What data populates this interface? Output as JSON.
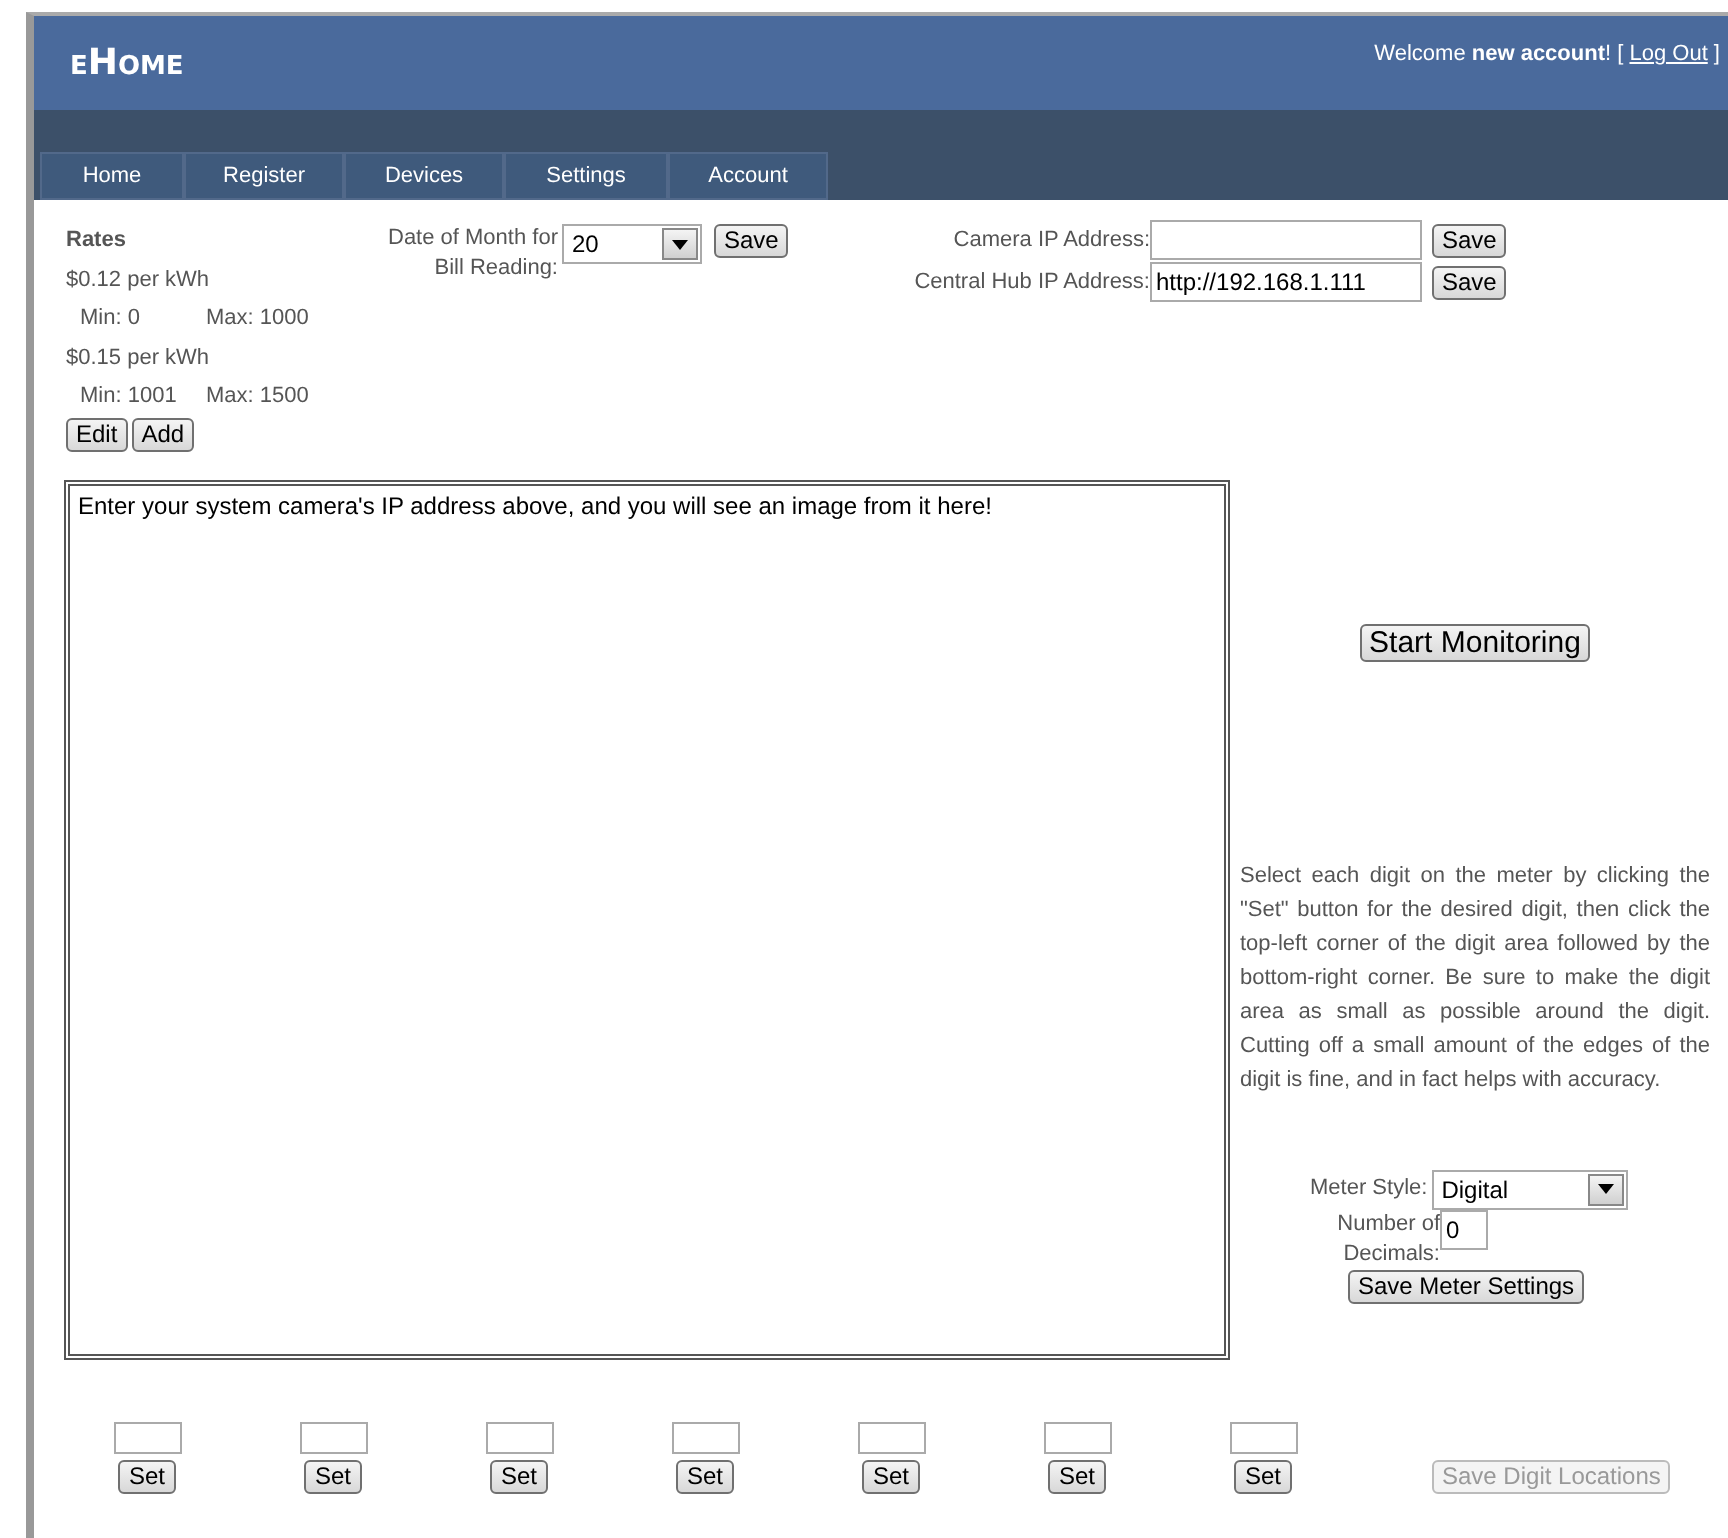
{
  "header": {
    "logo": "eHome",
    "welcome": "Welcome **new account**! [",
    "logout": "Log Out",
    "welcome_end": "]"
  },
  "tabs": [
    {
      "label": "Home",
      "selected": false
    },
    {
      "label": "Register",
      "selected": false
    },
    {
      "label": "Devices",
      "selected": false
    },
    {
      "label": "Settings",
      "selected": false
    },
    {
      "label": "Account",
      "selected": false
    }
  ],
  "rates": {
    "title": "Rates",
    "items": [
      {
        "price": "$0.12 per kWh",
        "min": "Min: 0",
        "max": "Max: 1000"
      },
      {
        "price": "$0.15 per kWh",
        "min": "Min: 1001",
        "max": "Max: 1500"
      }
    ],
    "buttons": [
      "Edit",
      "Add"
    ]
  },
  "bill_date": {
    "label": "Date of Month for Bill Reading:",
    "value": "20",
    "button": "Save"
  },
  "ip_fields": [
    {
      "label": "Camera IP Address:",
      "button": "Save"
    },
    {
      "label": "Central Hub IP Address:",
      "value": "http://192.168.1.111",
      "button": "Save"
    }
  ],
  "camera_view": {
    "message": "Enter your system camera's IP address above, and you will see an image from it here!"
  },
  "start_button": "Start Monitoring",
  "instructions": "Select each digit on the meter by clicking the \"Set\" button for the desired digit, then click the top-left corner of the digit area followed by the bottom-right corner. Be sure to make the digit area as small as possible around the digit. Cutting off a small amount of the edges of the digit is fine, and in fact helps with accuracy.",
  "meter_style": {
    "label": "Meter Style:",
    "value": "Digital"
  },
  "decimals": {
    "label": "Number of Decimals:",
    "value": "0"
  },
  "save_meter_button": "Save Meter Settings",
  "digits": [
    {
      "button": "Set"
    },
    {
      "button": "Set"
    },
    {
      "button": "Set"
    },
    {
      "button": "Set"
    },
    {
      "button": "Set"
    },
    {
      "button": "Set"
    },
    {
      "button": "Set"
    }
  ],
  "save_digits": {
    "label": "Save Digit Locations",
    "disabled": true
  }
}
